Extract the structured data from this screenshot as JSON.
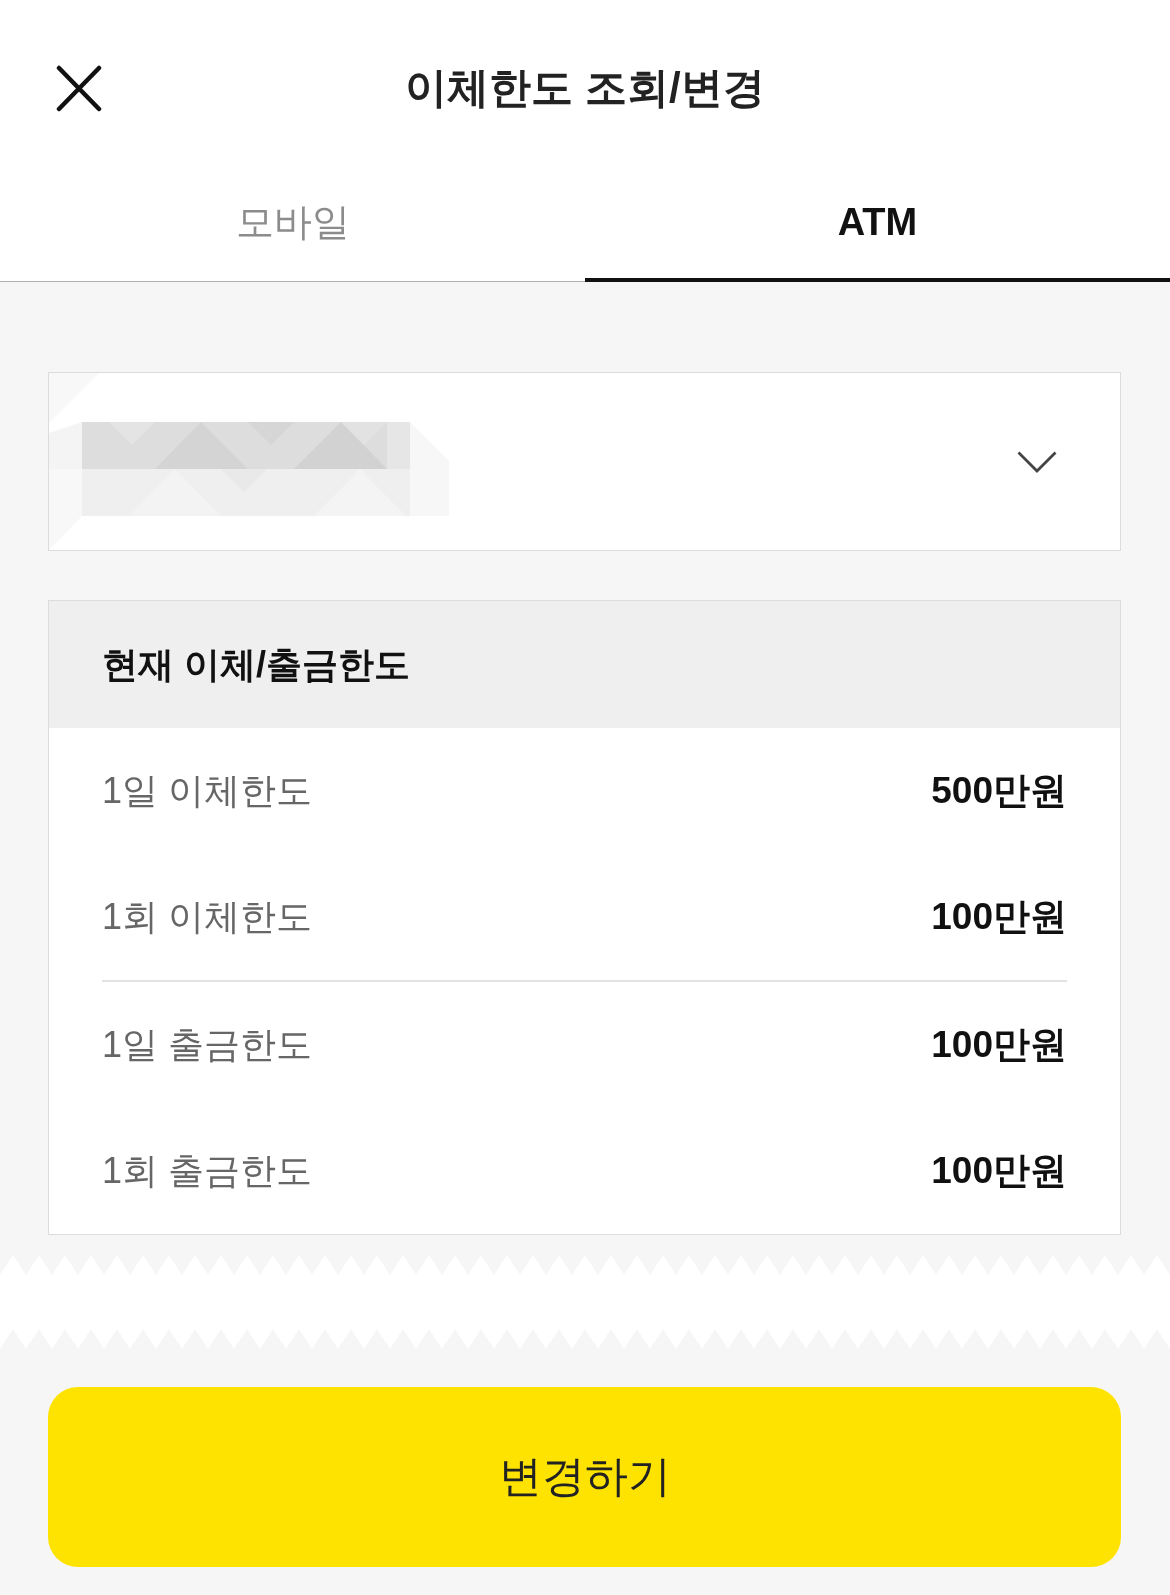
{
  "header": {
    "title": "이체한도 조회/변경"
  },
  "tabs": [
    {
      "label": "모바일",
      "selected": false
    },
    {
      "label": "ATM",
      "selected": true
    }
  ],
  "limits": {
    "title": "현재 이체/출금한도",
    "groups": [
      {
        "rows": [
          {
            "label": "1일 이체한도",
            "value": "500만원"
          },
          {
            "label": "1회 이체한도",
            "value": "100만원"
          }
        ]
      },
      {
        "rows": [
          {
            "label": "1일 출금한도",
            "value": "100만원"
          },
          {
            "label": "1회 출금한도",
            "value": "100만원"
          }
        ]
      }
    ]
  },
  "button": {
    "label": "변경하기"
  }
}
